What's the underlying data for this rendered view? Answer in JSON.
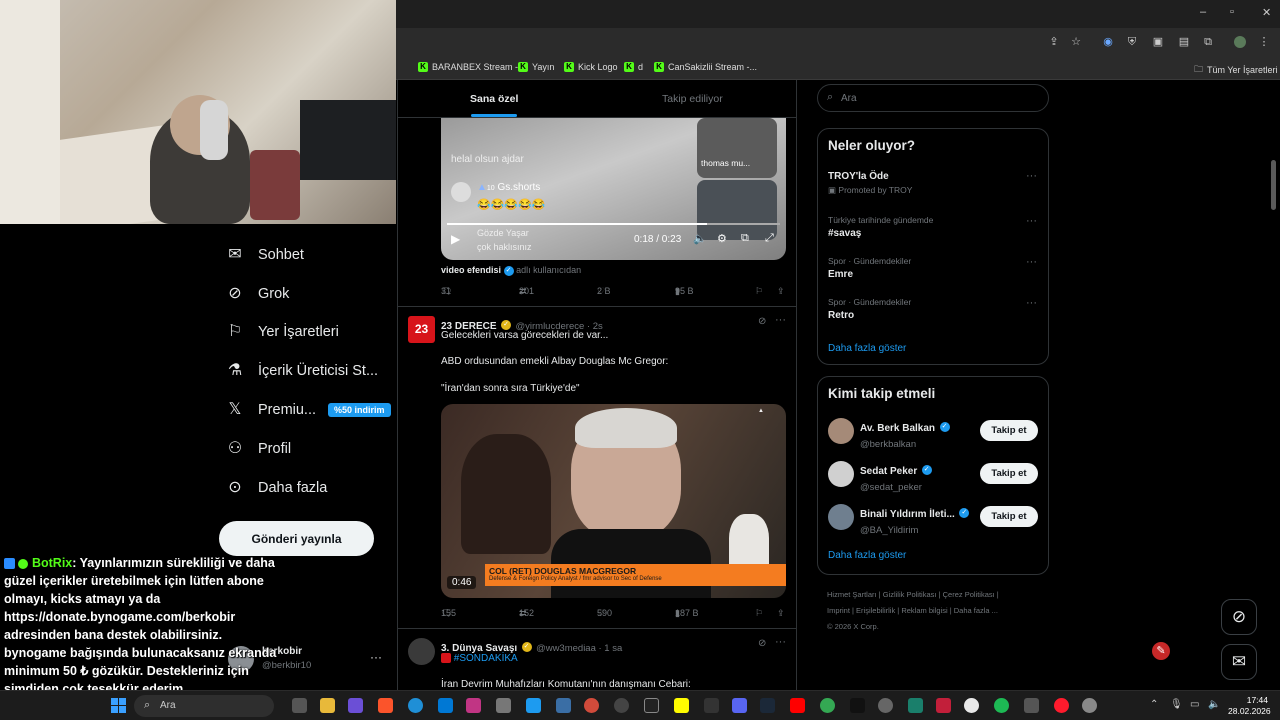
{
  "browser": {
    "bookmarks": [
      "BARANBEX Stream -...",
      "Yayın",
      "Kick Logo",
      "d",
      "CanSakizlii Stream -..."
    ],
    "all_bookmarks": "Tüm Yer İşaretleri"
  },
  "nav": {
    "items": [
      {
        "label": "Sohbet",
        "icon": "mail-icon"
      },
      {
        "label": "Grok",
        "icon": "grok-icon"
      },
      {
        "label": "Yer İşaretleri",
        "icon": "bookmark-icon"
      },
      {
        "label": "İçerik Üreticisi St...",
        "icon": "creator-icon"
      },
      {
        "label": "Premiu...",
        "icon": "x-logo-icon"
      },
      {
        "label": "Profil",
        "icon": "person-icon"
      },
      {
        "label": "Daha fazla",
        "icon": "more-circle-icon"
      }
    ],
    "premium_badge": "%50 indirim",
    "post_button": "Gönderi yayınla",
    "account_name": "berkobir",
    "account_handle": "@berkbir10"
  },
  "chat": {
    "user": "BotRix",
    "message": ": Yayınlarımızın sürekliliği ve daha güzel içerikler üretebilmek için lütfen abone olmayı, kicks atmayı ya da https://donate.bynogame.com/berkobir adresinden bana destek olabilirsiniz. bynogame bağışında bulunacaksanız ekranda minimum 50 ₺ gözükür. Destekleriniz için şimdiden çok teşekkür ederim."
  },
  "feed": {
    "tabs": [
      "Sana özel",
      "Takip ediliyor"
    ],
    "video1": {
      "time": "0:18 / 0:23",
      "overlay_comments": [
        "helal olsun ajdar",
        "Gs.shorts",
        "Gözde Yaşar",
        "çok haklısınız"
      ],
      "overlay_count": "10",
      "side_name": "thomas mu...",
      "source_name": "video efendisi",
      "source_suffix": "adlı kullanıcıdan"
    },
    "tweet1_stats": {
      "replies": "31",
      "reposts": "201",
      "likes": "2 B",
      "views": "95 B"
    },
    "tweet2": {
      "name": "23 DERECE",
      "handle": "@yirmlucderece · 2s",
      "line1": "Gelecekleri varsa görecekleri de var...",
      "line2": "ABD ordusundan emekli Albay Douglas Mc Gregor:",
      "line3": "\"İran'dan sonra sıra Türkiye'de\"",
      "video_duration": "0:46",
      "lower_third_name": "COL (RET) DOUGLAS MACGREGOR",
      "lower_third_sub": "Defense & Foreign Policy Analyst / fmr advisor to Sec of Defense",
      "stats": {
        "replies": "155",
        "reposts": "152",
        "likes": "590",
        "views": "187 B"
      }
    },
    "tweet3": {
      "name": "3. Dünya Savaşı",
      "handle": "@ww3mediaa · 1 sa",
      "tag": "#SONDAKİKA",
      "line1": "İran Devrim Muhafızları Komutanı'nın danışmanı Cebari:"
    }
  },
  "sidebar": {
    "search_placeholder": "Ara",
    "trends_title": "Neler oluyor?",
    "trends": [
      {
        "title": "TROY'la Öde",
        "meta": "Promoted by TROY"
      },
      {
        "meta": "Türkiye tarihinde gündemde",
        "title": "#savaş"
      },
      {
        "meta": "Spor · Gündemdekiler",
        "title": "Emre"
      },
      {
        "meta": "Spor · Gündemdekiler",
        "title": "Retro"
      }
    ],
    "show_more": "Daha fazla göster",
    "follow_title": "Kimi takip etmeli",
    "follow": [
      {
        "name": "Av. Berk Balkan",
        "handle": "@berkbalkan"
      },
      {
        "name": "Sedat Peker",
        "handle": "@sedat_peker"
      },
      {
        "name": "Binali Yıldırım İleti...",
        "handle": "@BA_Yildirim"
      }
    ],
    "follow_button": "Takip et",
    "footer": [
      "Hizmet Şartları",
      "Gizlilik Politikası",
      "Çerez Politikası",
      "Imprint",
      "Erişilebilirlik",
      "Reklam bilgisi",
      "Daha fazla ...",
      "© 2026 X Corp."
    ]
  },
  "taskbar": {
    "search": "Ara",
    "time": "17:44",
    "date": "28.02.2026"
  },
  "colors": {
    "accent": "#1d9bf0",
    "kick": "#53fc18",
    "background": "#000000"
  }
}
